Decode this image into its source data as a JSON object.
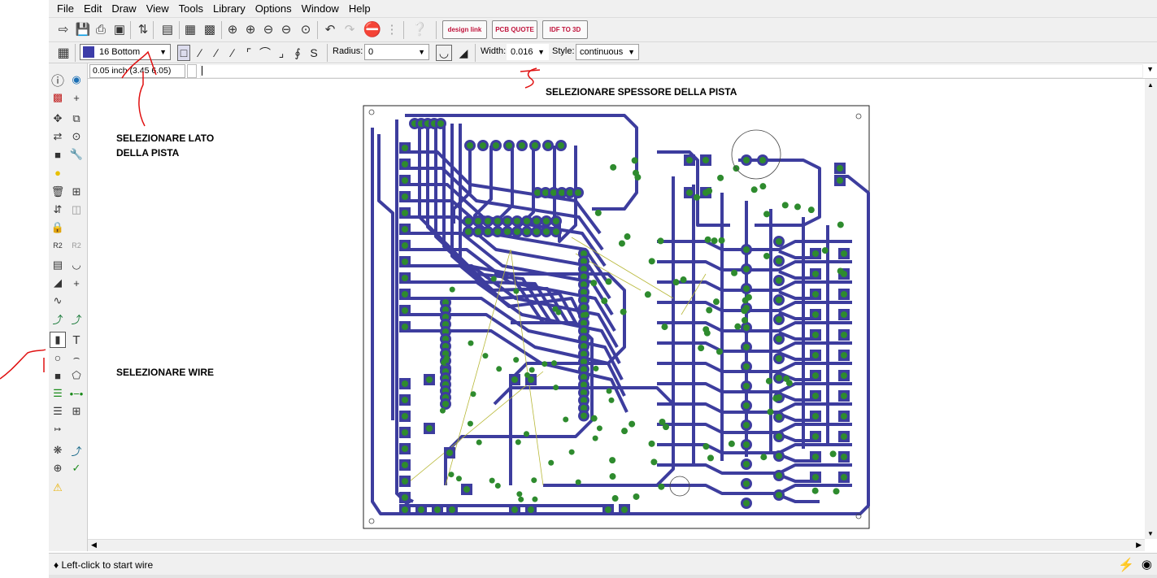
{
  "menu": [
    "File",
    "Edit",
    "Draw",
    "View",
    "Tools",
    "Library",
    "Options",
    "Window",
    "Help"
  ],
  "toolbar": {
    "designlink_label": "design link",
    "pcbquote_label": "PCB QUOTE",
    "idf_label": "IDF TO 3D"
  },
  "wire_toolbar": {
    "layer": "16 Bottom",
    "layer_color": "#3c3ca8",
    "radius_label": "Radius:",
    "radius_value": "0",
    "width_label": "Width:",
    "width_value": "0.016",
    "style_label": "Style:",
    "style_value": "continuous"
  },
  "command_bar": {
    "coordinates": "0.05 inch (3.45 6.05)",
    "command": ""
  },
  "status": {
    "message": "♦ Left-click to start wire"
  },
  "annotations": {
    "layer_note": [
      "SELEZIONARE LATO",
      "DELLA PISTA"
    ],
    "width_note": "SELEZIONARE SPESSORE DELLA PISTA",
    "wire_note": "SELEZIONARE WIRE"
  },
  "colors": {
    "trace": "#3d3d9e",
    "pad": "#2e8b2e",
    "ratsnest": "#b8b838",
    "annotation_ink": "#e01010"
  }
}
